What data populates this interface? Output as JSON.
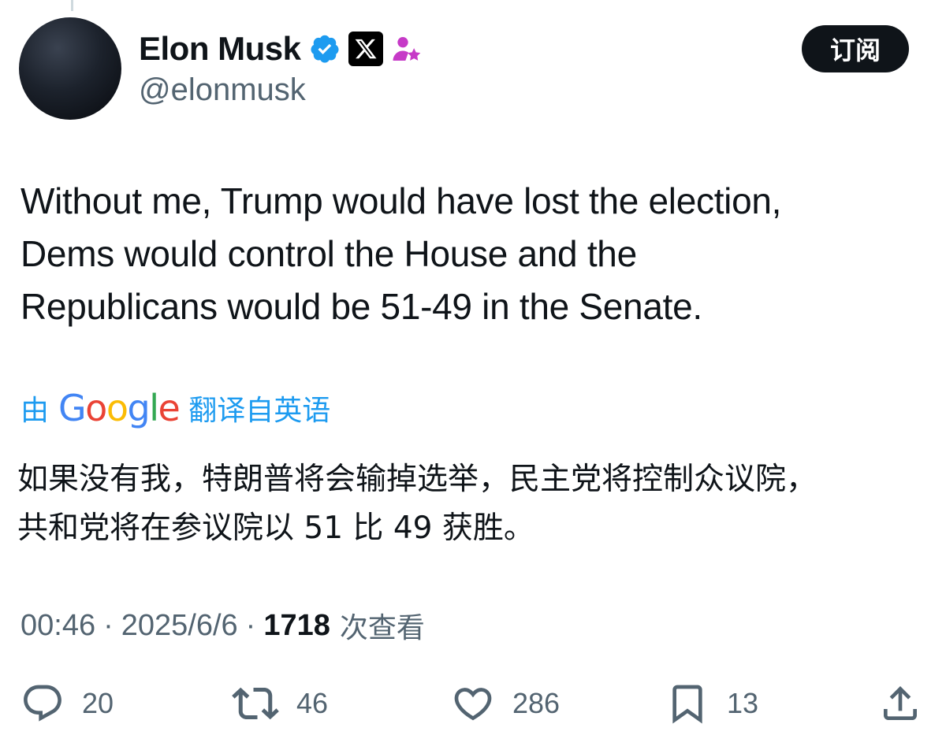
{
  "author": {
    "display_name": "Elon Musk",
    "handle": "@elonmusk",
    "verified_icon": "verified-badge-icon",
    "affiliate_icon": "x-logo-icon",
    "extra_icon": "person-star-icon"
  },
  "subscribe_label": "订阅",
  "tweet": {
    "text_lines": [
      "Without me, Trump would have lost the election,",
      "Dems would control the House and the",
      "Republicans would be 51-49 in the Senate."
    ]
  },
  "translation": {
    "by": "由",
    "provider": "Google",
    "translated_from": "翻译自英语",
    "text_lines": [
      "如果没有我，特朗普将会输掉选举，民主党将控制众议院，",
      "共和党将在参议院以 51 比 49 获胜。"
    ]
  },
  "meta": {
    "time": "00:46",
    "separator": "·",
    "date": "2025/6/6",
    "views_count": "1718",
    "views_label": "次查看"
  },
  "actions": {
    "replies": "20",
    "reposts": "46",
    "likes": "286",
    "bookmarks": "13"
  },
  "colors": {
    "accent": "#1d9bf0",
    "text_primary": "#0f1419",
    "text_secondary": "#536471",
    "button_bg": "#0f1419",
    "purple_icon": "#c63ac7"
  }
}
